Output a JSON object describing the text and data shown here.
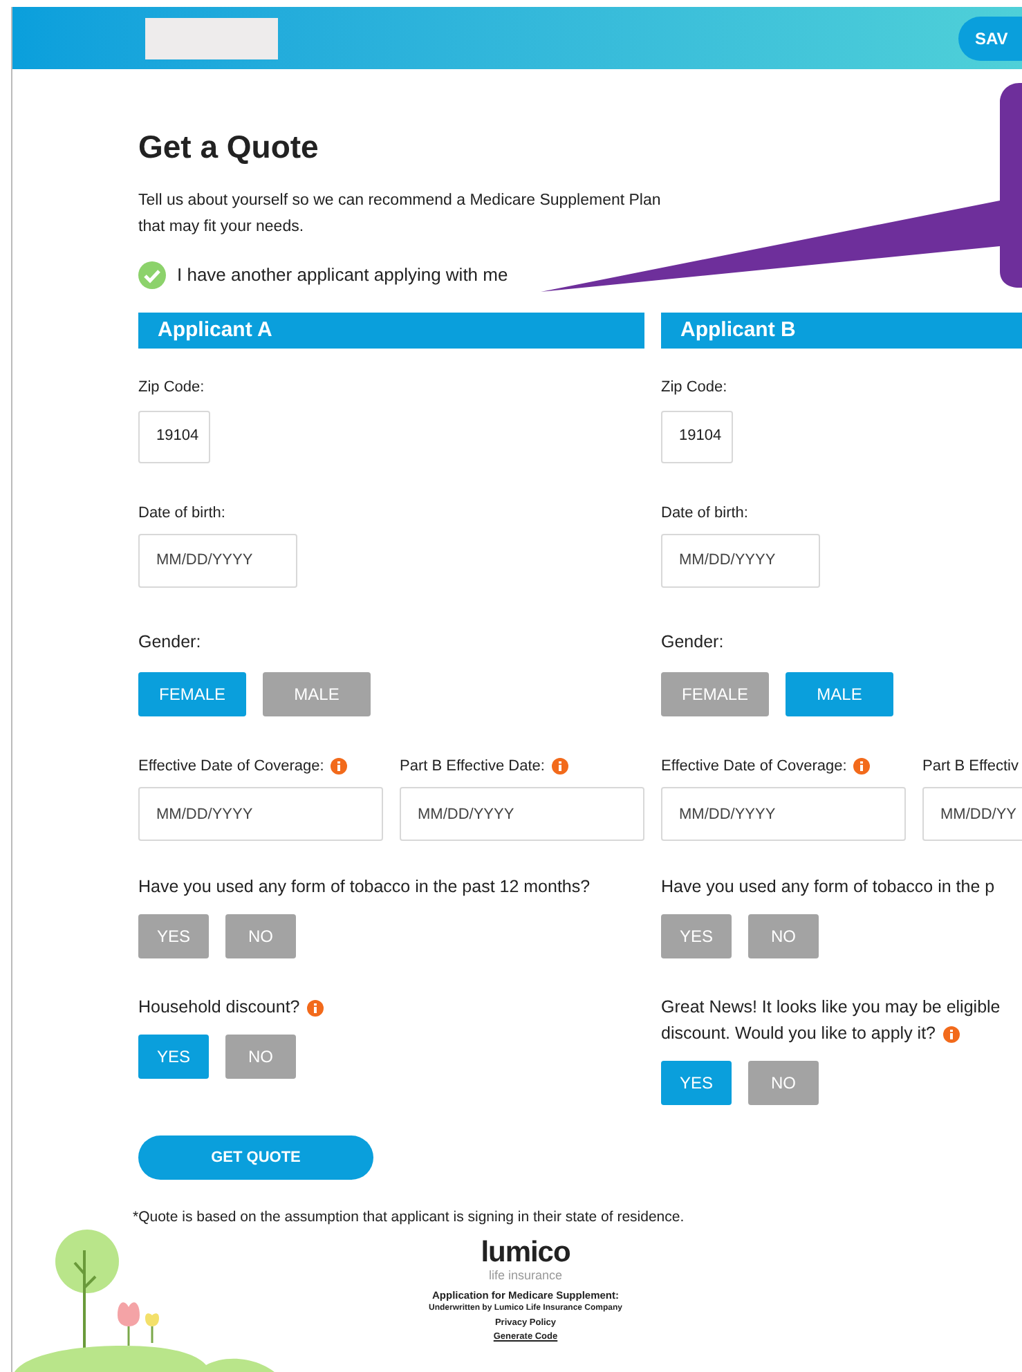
{
  "header": {
    "save_button": "SAV"
  },
  "title": "Get a Quote",
  "intro": "Tell us about yourself so we can recommend a Medicare Supplement Plan\nthat may fit your needs.",
  "another_applicant": {
    "label": "I have another applicant applying with me",
    "checked": true
  },
  "applicants": [
    {
      "heading": "Applicant A",
      "zip_label": "Zip Code:",
      "zip_value": "19104",
      "dob_label": "Date of birth:",
      "dob_placeholder": "MM/DD/YYYY",
      "gender_label": "Gender:",
      "gender_options": [
        {
          "label": "FEMALE",
          "selected": true
        },
        {
          "label": "MALE",
          "selected": false
        }
      ],
      "coverage_label": "Effective Date of Coverage:",
      "coverage_placeholder": "MM/DD/YYYY",
      "partb_label": "Part B Effective Date:",
      "partb_placeholder": "MM/DD/YYYY",
      "tobacco_question": "Have you used any form of tobacco in the past 12 months?",
      "tobacco_options": [
        {
          "label": "YES",
          "selected": false
        },
        {
          "label": "NO",
          "selected": false
        }
      ],
      "discount_question": [
        "Household discount?"
      ],
      "discount_options": [
        {
          "label": "YES",
          "selected": true
        },
        {
          "label": "NO",
          "selected": false
        }
      ]
    },
    {
      "heading": "Applicant B",
      "zip_label": "Zip Code:",
      "zip_value": "19104",
      "dob_label": "Date of birth:",
      "dob_placeholder": "MM/DD/YYYY",
      "gender_label": "Gender:",
      "gender_options": [
        {
          "label": "FEMALE",
          "selected": false
        },
        {
          "label": "MALE",
          "selected": true
        }
      ],
      "coverage_label": "Effective Date of Coverage:",
      "coverage_placeholder": "MM/DD/YYYY",
      "partb_label": "Part B Effectiv",
      "partb_placeholder": "MM/DD/YY",
      "tobacco_question": "Have you used any form of tobacco in the p",
      "tobacco_options": [
        {
          "label": "YES",
          "selected": false
        },
        {
          "label": "NO",
          "selected": false
        }
      ],
      "discount_question": [
        "Great News! It looks like you may be eligible",
        "discount. Would you like to apply it?"
      ],
      "discount_options": [
        {
          "label": "YES",
          "selected": true
        },
        {
          "label": "NO",
          "selected": false
        }
      ]
    }
  ],
  "get_quote_button": "GET QUOTE",
  "disclaimer": "*Quote is based on the assumption that applicant is signing in their state of residence.",
  "footer": {
    "brand": "lumico",
    "tagline": "life insurance",
    "application": "Application for Medicare Supplement:",
    "underwritten": "Underwritten by Lumico Life Insurance Company",
    "privacy_link": "Privacy Policy",
    "generate_link": "Generate Code"
  }
}
